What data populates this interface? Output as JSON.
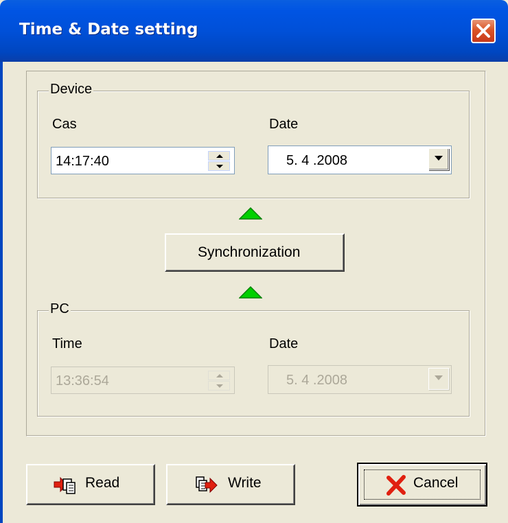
{
  "window": {
    "title": "Time & Date setting"
  },
  "device": {
    "group_label": "Device",
    "time_label": "Cas",
    "time_value": "14:17:40",
    "date_label": "Date",
    "date_value": "5. 4 .2008"
  },
  "sync_button": {
    "label": "Synchronization"
  },
  "pc": {
    "group_label": "PC",
    "time_label": "Time",
    "time_value": "13:36:54",
    "date_label": "Date",
    "date_value": "5. 4 .2008"
  },
  "buttons": {
    "read": "Read",
    "write": "Write",
    "cancel": "Cancel"
  },
  "colors": {
    "arrow_green": "#00D000",
    "title_blue": "#0054E3",
    "close_red": "#DA5527",
    "cancel_x_red": "#E02010"
  },
  "icons": [
    "close-icon",
    "spin-up-icon",
    "spin-down-icon",
    "dropdown-arrow-icon",
    "sync-up-arrow-icon",
    "read-icon",
    "write-icon",
    "cancel-x-icon"
  ]
}
